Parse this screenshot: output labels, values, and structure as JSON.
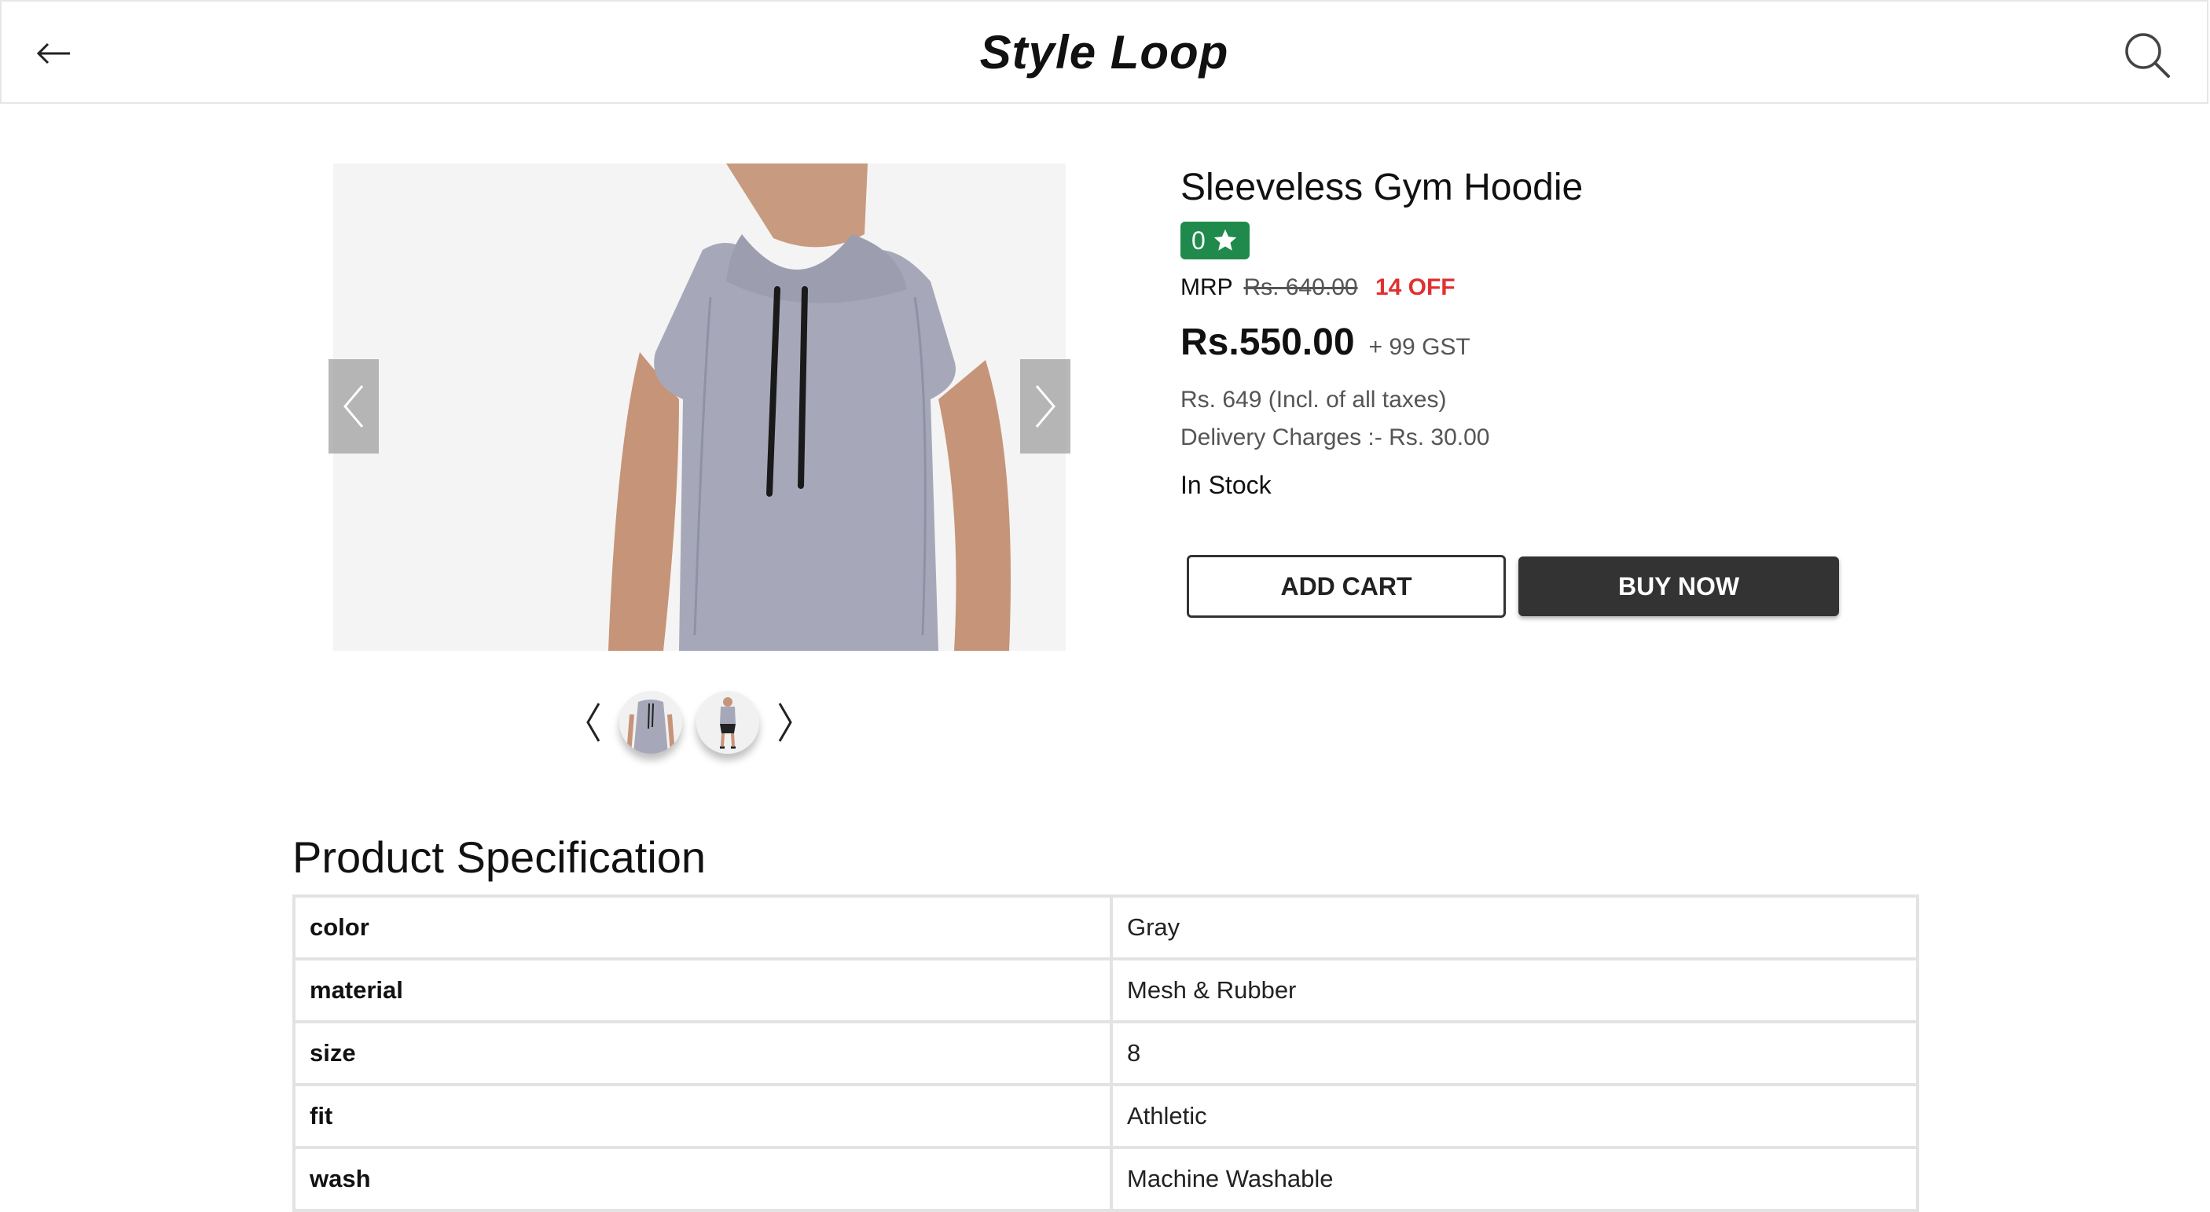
{
  "header": {
    "brand": "Style Loop",
    "back_icon": "arrow-left-icon",
    "search_icon": "search-icon"
  },
  "product": {
    "title": "Sleeveless Gym Hoodie",
    "rating": "0",
    "mrp_label": "MRP",
    "mrp_value": "Rs. 640.00",
    "discount": "14 OFF",
    "price": "Rs.550.00",
    "gst": "+ 99 GST",
    "incl_taxes": "Rs. 649 (Incl. of all taxes)",
    "delivery": "Delivery Charges :- Rs. 30.00",
    "stock": "In Stock"
  },
  "actions": {
    "add_cart": "ADD CART",
    "buy_now": "BUY NOW"
  },
  "specification": {
    "title": "Product Specification",
    "rows": [
      {
        "key": "color",
        "value": "Gray"
      },
      {
        "key": "material",
        "value": "Mesh & Rubber"
      },
      {
        "key": "size",
        "value": "8"
      },
      {
        "key": "fit",
        "value": "Athletic"
      },
      {
        "key": "wash",
        "value": "Machine Washable"
      }
    ]
  },
  "colors": {
    "rating_badge": "#1f8a4c",
    "discount": "#e03131",
    "buy_button": "#333333",
    "hoodie": "#a6a8ba"
  }
}
